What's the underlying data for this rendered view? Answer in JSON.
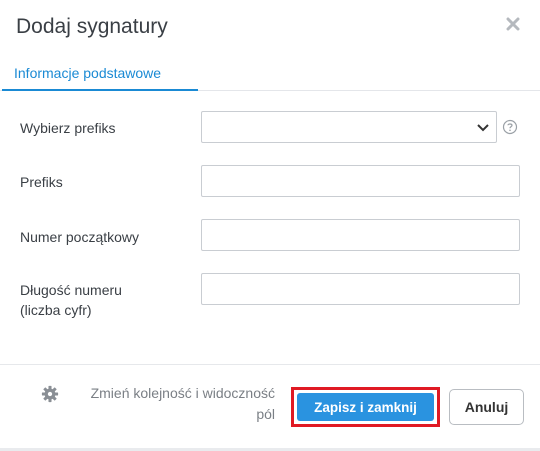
{
  "dialog": {
    "title": "Dodaj sygnatury",
    "close_icon": "close-icon"
  },
  "tabs": [
    {
      "label": "Informacje podstawowe",
      "active": true
    }
  ],
  "form": {
    "select_prefix": {
      "label": "Wybierz prefiks",
      "value": "",
      "icon": "chevron-down-icon",
      "help_icon": "question-icon"
    },
    "prefix": {
      "label": "Prefiks",
      "value": ""
    },
    "start_number": {
      "label": "Numer początkowy",
      "value": ""
    },
    "number_length": {
      "label_line1": "Długość numeru",
      "label_line2": "(liczba cyfr)",
      "value": ""
    }
  },
  "footer": {
    "reorder_link_line1": "Zmień kolejność i widoczność",
    "reorder_link_line2": "pól",
    "reorder_icon": "gear-icon",
    "save_label": "Zapisz i zamknij",
    "cancel_label": "Anuluj"
  },
  "colors": {
    "accent": "#1a8ad4",
    "save_button": "#2a93e0",
    "highlight_frame": "#e01a24"
  }
}
